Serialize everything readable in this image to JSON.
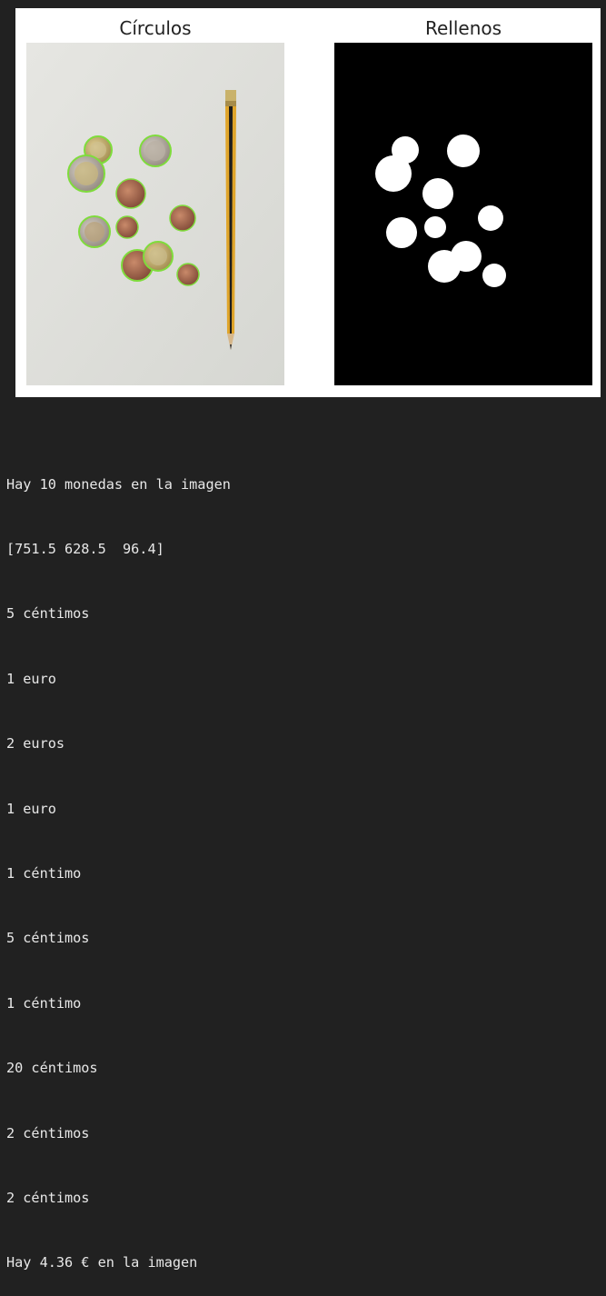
{
  "figure": {
    "left_title": "Círculos",
    "right_title": "Rellenos"
  },
  "output": {
    "lines": [
      "Hay 10 monedas en la imagen",
      "[751.5 628.5  96.4]",
      "5 céntimos",
      "1 euro",
      "2 euros",
      "1 euro",
      "1 céntimo",
      "5 céntimos",
      "1 céntimo",
      "20 céntimos",
      "2 céntimos",
      "2 céntimos",
      "Hay 4.36 € en la imagen"
    ]
  },
  "colors": {
    "background": "#212121",
    "detected_circle": "#7fdc3c",
    "fill": "#ffffff"
  }
}
